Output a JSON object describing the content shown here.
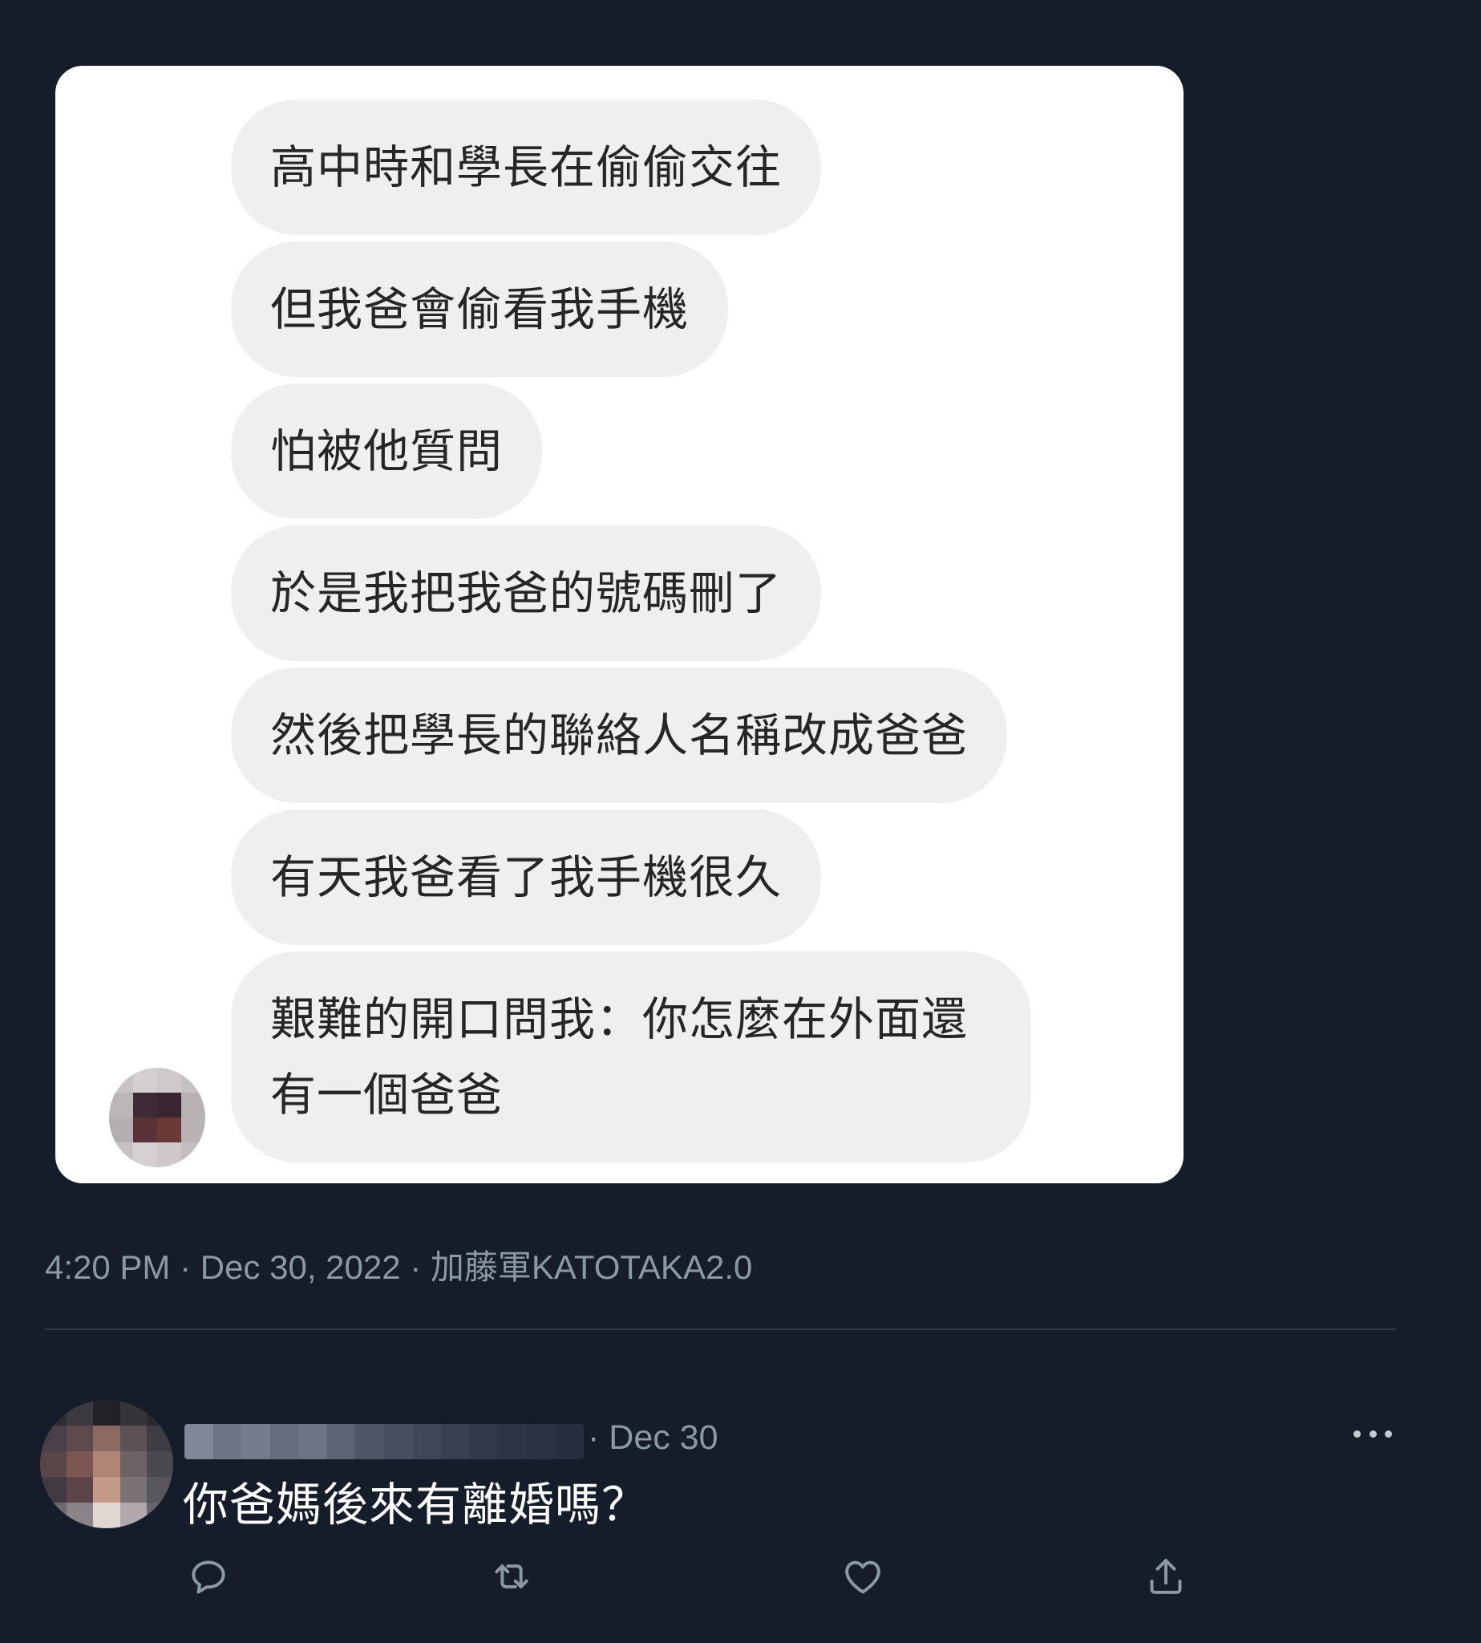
{
  "screenshot": {
    "messages": [
      "高中時和學長在偷偷交往",
      "但我爸會偷看我手機",
      "怕被他質問",
      "於是我把我爸的號碼刪了",
      "然後把學長的聯絡人名稱改成爸爸",
      "有天我爸看了我手機很久",
      "艱難的開口問我：你怎麼在外面還有一個爸爸"
    ],
    "bubble_color": "#efefef",
    "text_color": "#262626"
  },
  "tweet": {
    "meta": "4:20 PM · Dec 30, 2022 · 加藤軍KATOTAKA2.0"
  },
  "reply": {
    "date": "· Dec 30",
    "text": "你爸媽後來有離婚嗎？",
    "actions": [
      "reply-icon",
      "retweet-icon",
      "like-icon",
      "share-icon"
    ]
  },
  "colors": {
    "background": "#151d2a",
    "secondary_text": "#8b98a5",
    "icon": "#8b98a5",
    "divider": "#2f3a48"
  }
}
